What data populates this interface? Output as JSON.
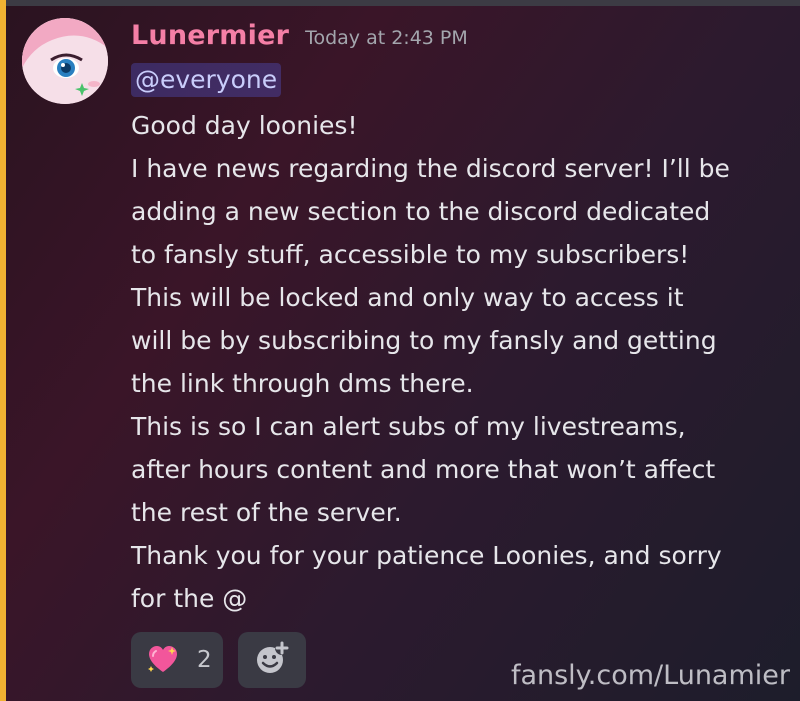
{
  "message": {
    "author": "Lunermier",
    "timestamp": "Today at 2:43 PM",
    "mention": "@everyone",
    "lines": [
      "Good day loonies!",
      "I have news regarding the discord server! I’ll be",
      "adding a new section to the discord dedicated",
      "to fansly stuff, accessible to my subscribers!",
      "This will be locked and only way to access it",
      "will be by subscribing to my fansly and getting",
      "the link through dms there.",
      "This is so I can alert subs of my livestreams,",
      "after hours content and more that won’t affect",
      "the rest of the server.",
      "Thank you for your patience Loonies, and sorry",
      "for the @"
    ]
  },
  "reactions": [
    {
      "emoji": "sparkling-heart-icon",
      "count": "2"
    }
  ],
  "add_reaction_icon": "add-reaction-icon",
  "watermark": "fansly.com/Lunamier",
  "colors": {
    "author": "#f47fa6",
    "mention_highlight": "#f0b232",
    "mention_text": "#c9cdfb"
  }
}
